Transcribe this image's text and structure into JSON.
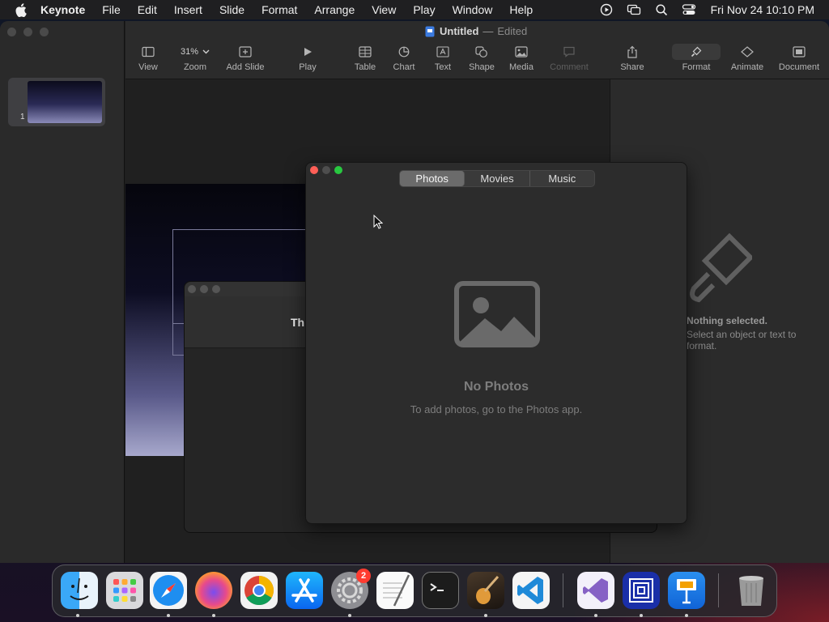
{
  "menubar": {
    "app_name": "Keynote",
    "items": [
      "File",
      "Edit",
      "Insert",
      "Slide",
      "Format",
      "Arrange",
      "View",
      "Play",
      "Window",
      "Help"
    ],
    "clock": "Fri Nov 24  10:10 PM"
  },
  "window": {
    "title": "Untitled",
    "separator": "—",
    "status": "Edited"
  },
  "toolbar": {
    "zoom_value": "31%",
    "items": [
      {
        "label": "View"
      },
      {
        "label": "Zoom"
      },
      {
        "label": "Add Slide"
      },
      {
        "label": "Play"
      },
      {
        "label": "Table"
      },
      {
        "label": "Chart"
      },
      {
        "label": "Text"
      },
      {
        "label": "Shape"
      },
      {
        "label": "Media"
      },
      {
        "label": "Comment"
      },
      {
        "label": "Share"
      },
      {
        "label": "Format"
      },
      {
        "label": "Animate"
      },
      {
        "label": "Document"
      }
    ]
  },
  "navigator": {
    "slide_number": "1"
  },
  "inspector": {
    "empty_title": "Nothing selected.",
    "empty_subtitle": "Select an object or text to format."
  },
  "back_dialog": {
    "text": "Th"
  },
  "media_browser": {
    "tabs": [
      "Photos",
      "Movies",
      "Music"
    ],
    "selected_tab": "Photos",
    "empty_title": "No Photos",
    "empty_subtitle": "To add photos, go to the Photos app."
  },
  "dock": {
    "apps": [
      "Finder",
      "Launchpad",
      "Safari",
      "Firefox",
      "Chrome",
      "App Store",
      "System Settings",
      "TextEdit",
      "Terminal",
      "GarageBand",
      "VS Code",
      "Visual Studio",
      "Archiver",
      "Keynote",
      "Trash"
    ],
    "settings_badge": "2"
  },
  "colors": {
    "accent_close": "#ff5f57",
    "accent_minimize": "#febc2e",
    "accent_zoom": "#28c840"
  }
}
